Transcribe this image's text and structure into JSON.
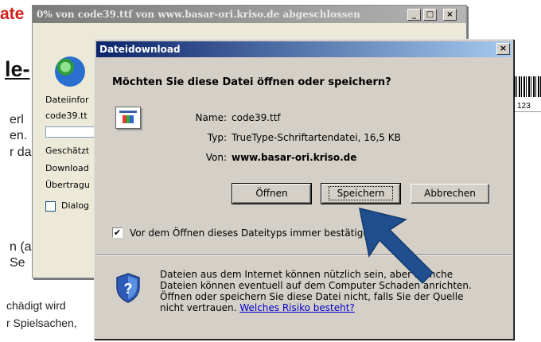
{
  "background_page": {
    "red_fragment": "ate",
    "heading_fragment": "le-",
    "lines": [
      "erl",
      "en.",
      "r da",
      "n (a",
      "Se",
      "chädigt wird",
      "r Spielsachen,"
    ],
    "barcode_number": "123"
  },
  "progress_window": {
    "title": "0% von code39.ttf von www.basar-ori.kriso.de abgeschlossen",
    "minimize": "_",
    "maximize": "□",
    "close": "×",
    "text_lines": [
      "Dateiinfor",
      "code39.tt",
      "Geschätzt",
      "Download",
      "Übertragu"
    ],
    "checkbox_label": "Dialog"
  },
  "dialog": {
    "title": "Dateidownload",
    "close": "×",
    "question": "Möchten Sie diese Datei öffnen oder speichern?",
    "name_label": "Name:",
    "name_value": "code39.ttf",
    "type_label": "Typ:",
    "type_value": "TrueType-Schriftartendatei, 16,5 KB",
    "from_label": "Von:",
    "from_value": "www.basar-ori.kriso.de",
    "buttons": {
      "open": "Öffnen",
      "save": "Speichern",
      "cancel": "Abbrechen"
    },
    "checkbox_checked": true,
    "checkbox_mark": "✔",
    "checkbox_label": "Vor dem Öffnen dieses Dateityps immer bestätigen",
    "warning_text": "Dateien aus dem Internet können nützlich sein, aber manche Dateien können eventuell auf dem Computer Schaden anrichten. Öffnen oder speichern Sie diese Datei nicht, falls Sie der Quelle nicht vertrauen.",
    "risk_link": "Welches Risiko besteht?"
  },
  "colors": {
    "titlebar_active": "#0a246a",
    "titlebar_inactive": "#7b7b7b",
    "dialog_face": "#d4d0c8",
    "arrow": "#1f4f8f",
    "link": "#0000cc"
  }
}
